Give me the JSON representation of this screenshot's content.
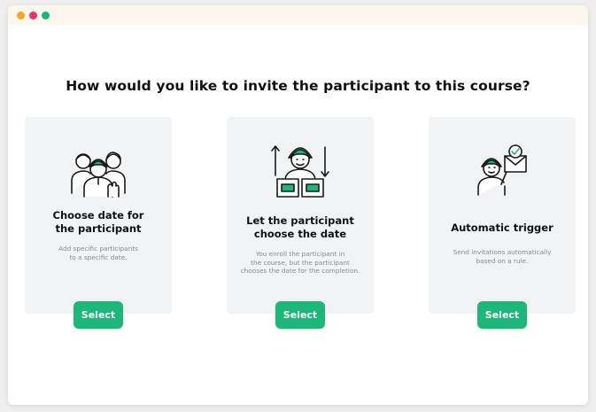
{
  "window": {
    "dots": [
      {
        "name": "close",
        "color": "#f5a623"
      },
      {
        "name": "minimize",
        "color": "#e8336d"
      },
      {
        "name": "maximize",
        "color": "#18b77a"
      }
    ]
  },
  "heading": "How would you like to invite the participant to this course?",
  "accent_color": "#1eb77a",
  "cards": [
    {
      "icon": "group-participants-icon",
      "title_lines": [
        "Choose date for",
        "the participant"
      ],
      "description_lines": [
        "Add specific participants",
        "to a specific date."
      ],
      "button_label": "Select"
    },
    {
      "icon": "participant-choose-date-icon",
      "title_lines": [
        "Let the participant",
        "choose the date"
      ],
      "description_lines": [
        "You enroll the participant in",
        "the course, but the participant",
        "chooses the date for the completion."
      ],
      "button_label": "Select"
    },
    {
      "icon": "automatic-trigger-icon",
      "title_lines": [
        "Automatic trigger"
      ],
      "description_lines": [
        "Send invitations automatically",
        "based on a rule."
      ],
      "button_label": "Select"
    }
  ]
}
